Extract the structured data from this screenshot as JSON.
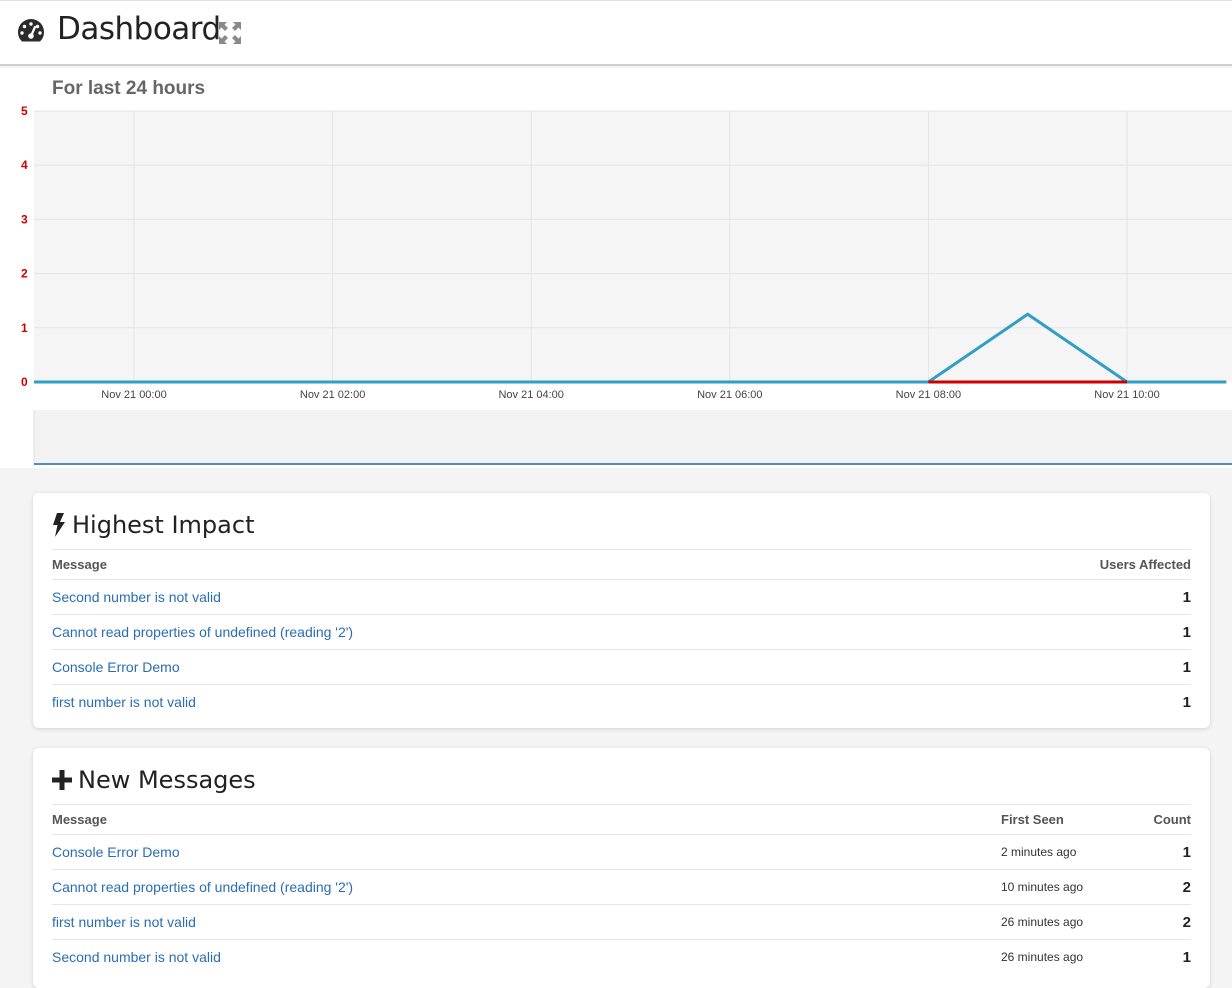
{
  "header": {
    "title": "Dashboard",
    "icons": {
      "dashboard": "dashboard-gauge-icon",
      "expand": "expand-arrows-icon"
    }
  },
  "chart_section": {
    "heading": "For last 24 hours"
  },
  "chart_data": {
    "type": "line",
    "y_ticks": [
      "0",
      "1",
      "2",
      "3",
      "4",
      "5"
    ],
    "ylim": [
      0,
      5
    ],
    "x_ticks": [
      "Nov 21 00:00",
      "Nov 21 02:00",
      "Nov 21 04:00",
      "Nov 21 06:00",
      "Nov 21 08:00",
      "Nov 21 10:00"
    ],
    "series": [
      {
        "color": "#2f9fc4",
        "points": [
          [
            "Nov 21 00:00",
            0
          ],
          [
            "Nov 21 08:00",
            0
          ],
          [
            "Nov 21 09:00",
            1.25
          ],
          [
            "Nov 21 10:00",
            0
          ],
          [
            "Nov 21 11:00",
            0
          ]
        ]
      },
      {
        "color": "#cc0000",
        "points": [
          [
            "Nov 21 08:00",
            0
          ],
          [
            "Nov 21 10:00",
            0
          ]
        ]
      }
    ],
    "grid": true,
    "navigator": true,
    "colors": {
      "y_tick_text": "#cc0000",
      "background": "#f5f5f5"
    }
  },
  "highest_impact": {
    "title": "Highest Impact",
    "icon": "bolt-icon",
    "columns": {
      "message": "Message",
      "users": "Users Affected"
    },
    "rows": [
      {
        "message": "Second number is not valid",
        "users": "1"
      },
      {
        "message": "Cannot read properties of undefined (reading '2')",
        "users": "1"
      },
      {
        "message": "Console Error Demo",
        "users": "1"
      },
      {
        "message": "first number is not valid",
        "users": "1"
      }
    ]
  },
  "new_messages": {
    "title": "New Messages",
    "icon": "plus-icon",
    "columns": {
      "message": "Message",
      "first_seen": "First Seen",
      "count": "Count"
    },
    "rows": [
      {
        "message": "Console Error Demo",
        "first_seen": "2 minutes ago",
        "count": "1"
      },
      {
        "message": "Cannot read properties of undefined (reading '2')",
        "first_seen": "10 minutes ago",
        "count": "2"
      },
      {
        "message": "first number is not valid",
        "first_seen": "26 minutes ago",
        "count": "2"
      },
      {
        "message": "Second number is not valid",
        "first_seen": "26 minutes ago",
        "count": "1"
      }
    ]
  }
}
